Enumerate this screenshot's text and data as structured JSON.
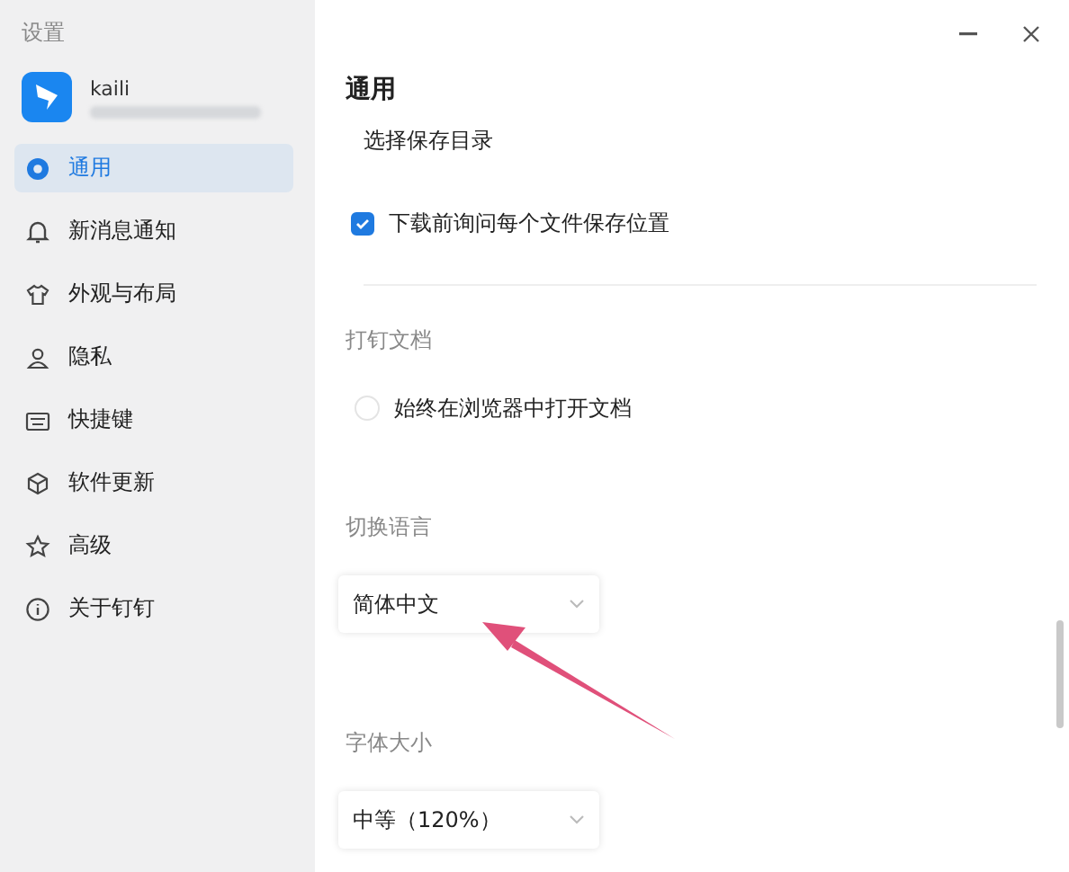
{
  "window": {
    "title": "设置"
  },
  "account": {
    "name": "kaili"
  },
  "sidebar": {
    "items": [
      {
        "label": "通用",
        "selected": true
      },
      {
        "label": "新消息通知",
        "selected": false
      },
      {
        "label": "外观与布局",
        "selected": false
      },
      {
        "label": "隐私",
        "selected": false
      },
      {
        "label": "快捷键",
        "selected": false
      },
      {
        "label": "软件更新",
        "selected": false
      },
      {
        "label": "高级",
        "selected": false
      },
      {
        "label": "关于钉钉",
        "selected": false
      }
    ]
  },
  "content": {
    "heading": "通用",
    "rows": [
      {
        "kind": "link",
        "label": "选择保存目录"
      },
      {
        "kind": "checkbox",
        "label": "下载前询问每个文件保存位置",
        "checked": true
      },
      {
        "kind": "divider"
      },
      {
        "kind": "section",
        "label": "打钉文档"
      },
      {
        "kind": "radio",
        "label": "始终在浏览器中打开文档",
        "selected": false
      },
      {
        "kind": "section",
        "label": "切换语言"
      },
      {
        "kind": "dropdown",
        "value": "简体中文"
      },
      {
        "kind": "section",
        "label": "字体大小"
      },
      {
        "kind": "dropdown",
        "value": "中等（120%）"
      }
    ]
  },
  "annotation": {
    "arrow": true
  }
}
